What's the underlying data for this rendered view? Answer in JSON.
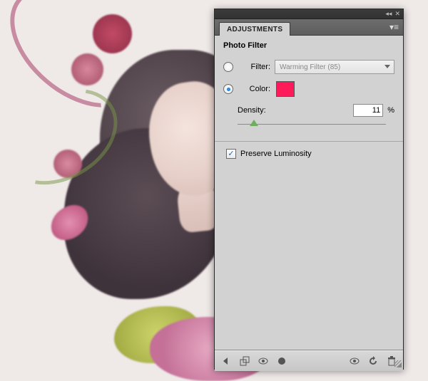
{
  "panel": {
    "tab_label": "ADJUSTMENTS",
    "titlebar": {
      "collapse": "◂◂",
      "close": "✕"
    },
    "section_title": "Photo Filter",
    "filter": {
      "radio_label": "Filter:",
      "selected": false,
      "dropdown_value": "Warming Filter (85)"
    },
    "color": {
      "radio_label": "Color:",
      "selected": true,
      "swatch_hex": "#ff1a5a"
    },
    "density": {
      "label": "Density:",
      "value": "11",
      "unit": "%"
    },
    "preserve_luminosity": {
      "label": "Preserve Luminosity",
      "checked": true
    }
  }
}
